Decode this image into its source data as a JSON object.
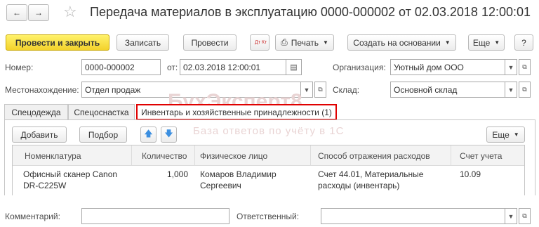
{
  "window": {
    "title": "Передача материалов в эксплуатацию 0000-000002 от 02.03.2018 12:00:01"
  },
  "toolbar": {
    "post_and_close": "Провести и закрыть",
    "save": "Записать",
    "post": "Провести",
    "dt_kt": "Дт Кт",
    "print": "Печать",
    "create_based": "Создать на основании",
    "more": "Еще",
    "help": "?"
  },
  "header": {
    "number_label": "Номер:",
    "number_value": "0000-000002",
    "date_label": "от:",
    "date_value": "02.03.2018 12:00:01",
    "org_label": "Организация:",
    "org_value": "Уютный дом ООО",
    "location_label": "Местонахождение:",
    "location_value": "Отдел продаж",
    "warehouse_label": "Склад:",
    "warehouse_value": "Основной склад"
  },
  "tabs": [
    {
      "label": "Спецодежда"
    },
    {
      "label": "Спецоснастка"
    },
    {
      "label": "Инвентарь и хозяйственные принадлежности (1)"
    }
  ],
  "table_toolbar": {
    "add": "Добавить",
    "pick": "Подбор",
    "more": "Еще"
  },
  "table": {
    "columns": [
      "Номенклатура",
      "Количество",
      "Физическое лицо",
      "Способ отражения расходов",
      "Счет учета"
    ],
    "rows": [
      {
        "item": "Офисный сканер Canon DR-C225W",
        "quantity": "1,000",
        "person": "Комаров Владимир Сергеевич",
        "expense_method": "Счет 44.01, Материальные расходы (инвентарь)",
        "account": "10.09"
      }
    ]
  },
  "footer": {
    "comment_label": "Комментарий:",
    "comment_value": "",
    "responsible_label": "Ответственный:",
    "responsible_value": ""
  },
  "watermark": {
    "brand": "БухЭксперт8",
    "tagline": "База ответов по учёту в 1С"
  },
  "colors": {
    "primary_button": "#f3d22b",
    "highlight_border": "#e00000",
    "arrow_blue": "#3c8fe0"
  }
}
